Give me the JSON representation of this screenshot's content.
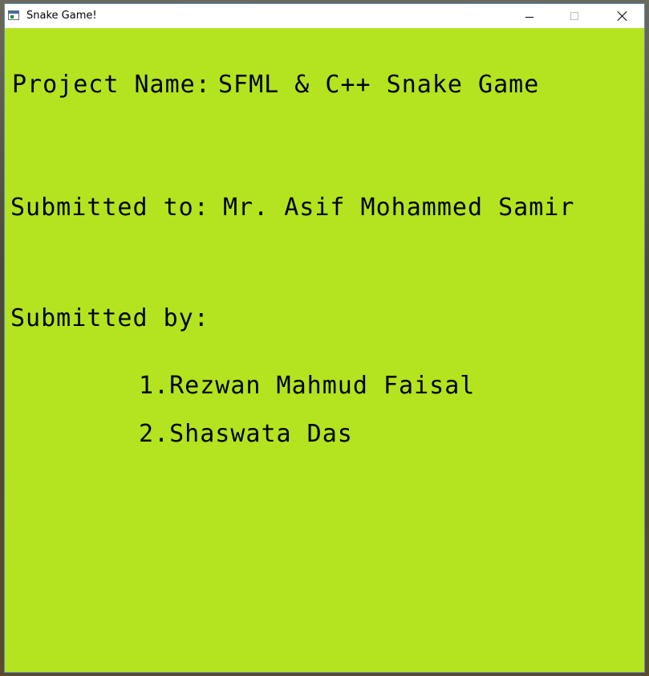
{
  "window": {
    "title": "Snake Game!",
    "controls": {
      "minimize_icon": "minimize-icon",
      "maximize_icon": "maximize-icon",
      "close_icon": "close-icon"
    }
  },
  "colors": {
    "canvas_background": "#b3e41f",
    "text": "#000000",
    "titlebar": "#ffffff"
  },
  "content": {
    "project_label": "Project Name:",
    "project_value": "SFML & C++ Snake Game",
    "submitted_to_label": "Submitted to:",
    "submitted_to_value": "Mr. Asif Mohammed Samir",
    "submitted_by_label": "Submitted by:",
    "members": [
      "1.Rezwan Mahmud Faisal",
      "2.Shaswata Das"
    ]
  }
}
